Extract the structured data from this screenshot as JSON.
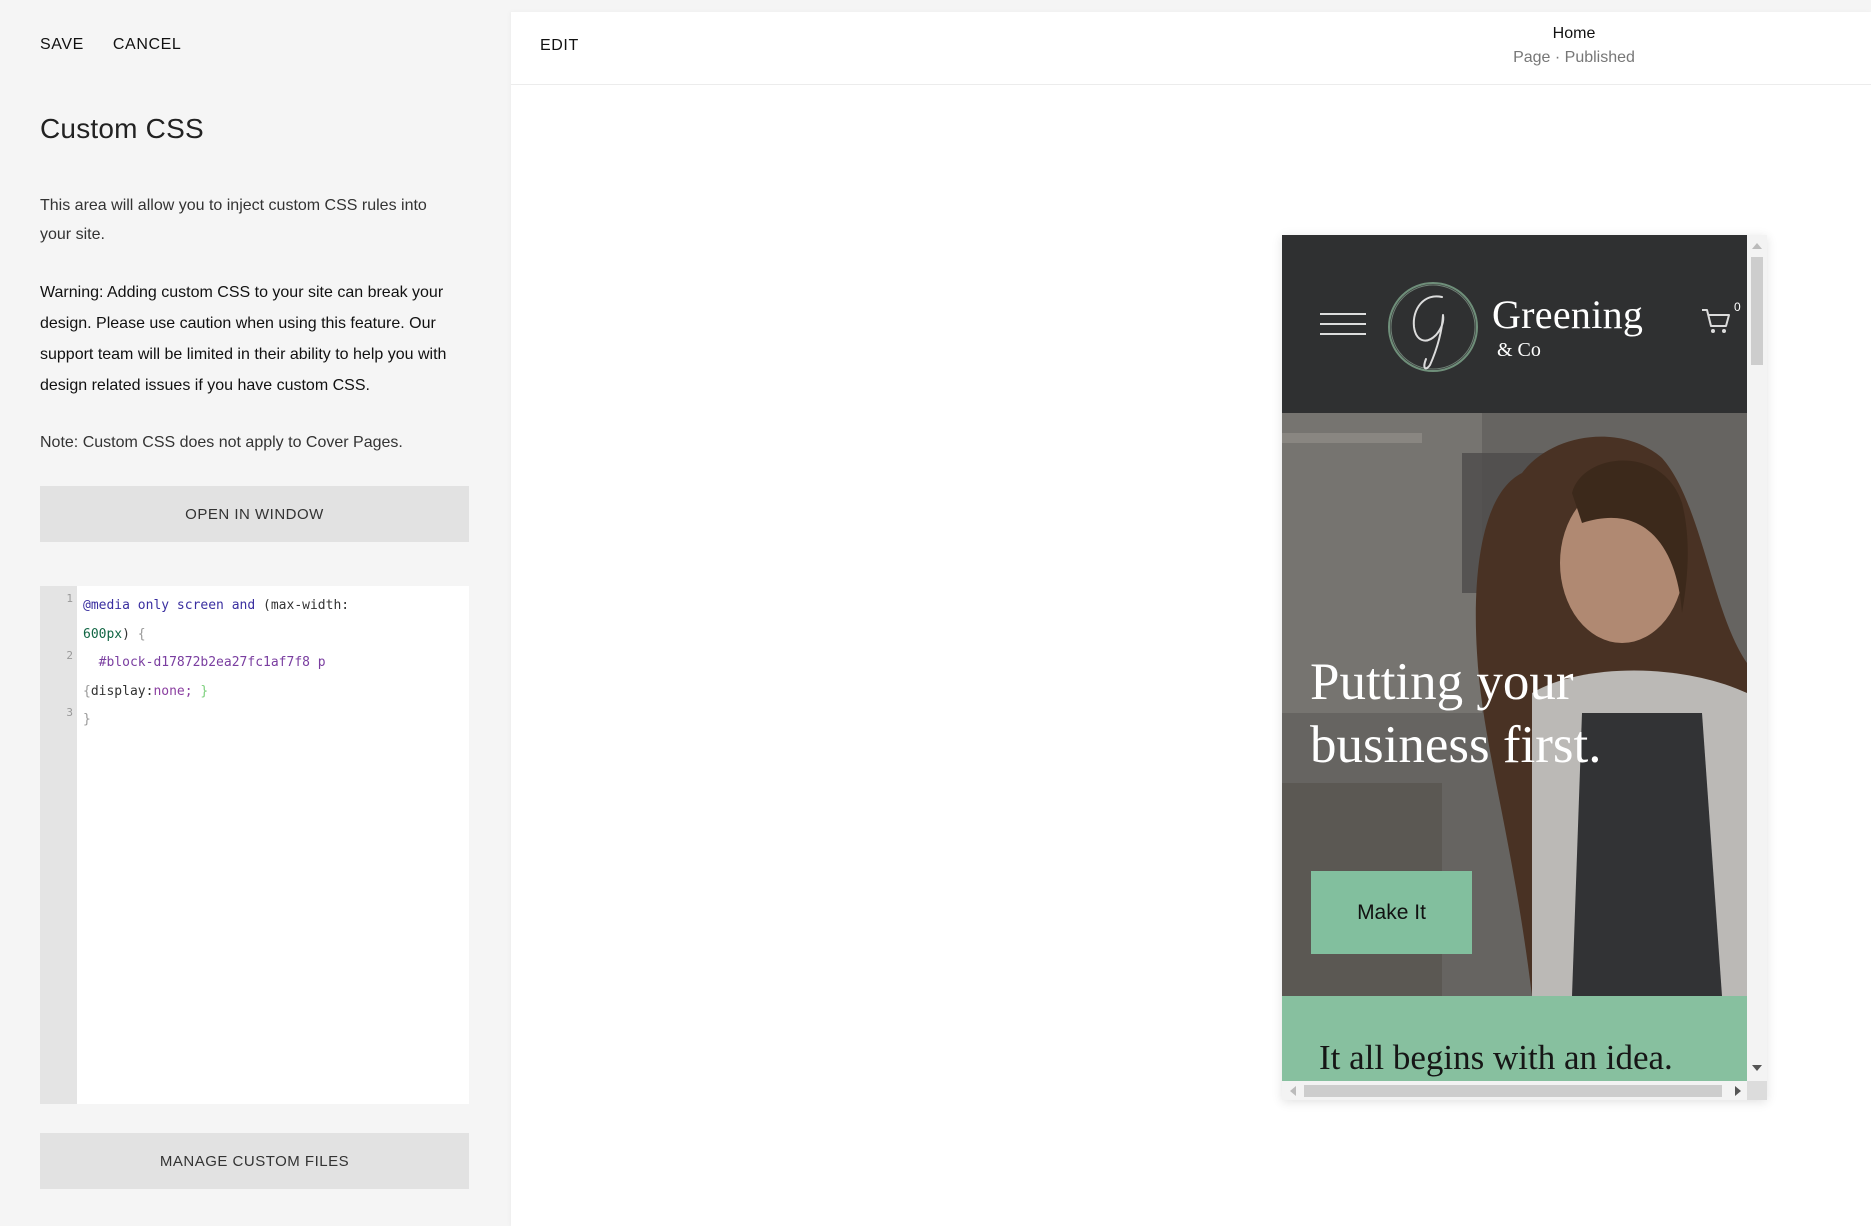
{
  "sidebar": {
    "save_label": "SAVE",
    "cancel_label": "CANCEL",
    "title": "Custom CSS",
    "intro": "This area will allow you to inject custom CSS rules into your site.",
    "warning": "Warning: Adding custom CSS to your site can break your design. Please use caution when using this feature. Our support team will be limited in their ability to help you with design related issues if you have custom CSS.",
    "note": "Note: Custom CSS does not apply to Cover Pages.",
    "open_window_label": "OPEN IN WINDOW",
    "manage_files_label": "MANAGE CUSTOM FILES"
  },
  "editor": {
    "line_numbers": [
      "1",
      "2",
      "3"
    ],
    "lines": [
      "@media only screen and (max-width: 600px) {",
      "#block-d17872b2ea27fc1af7f8 p {display:none; }",
      "}"
    ]
  },
  "preview": {
    "edit_label": "EDIT",
    "page_title": "Home",
    "page_status": "Page · Published"
  },
  "site": {
    "brand": "Greening",
    "brand_sub": "& Co",
    "cart_count": "0",
    "hero_headline": "Putting your business first.",
    "cta_label": "Make It",
    "section_text": "It all begins with an idea.",
    "colors": {
      "header_bg": "#2f3031",
      "accent": "#82bf9e"
    }
  }
}
